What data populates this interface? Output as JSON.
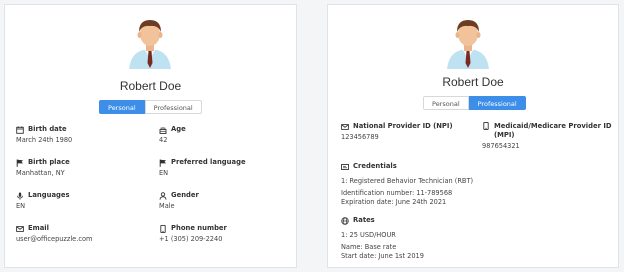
{
  "personal_card": {
    "name": "Robert Doe",
    "tabs": [
      {
        "label": "Personal",
        "active": true
      },
      {
        "label": "Professional",
        "active": false
      }
    ],
    "fields": [
      {
        "label": "Birth date",
        "value": "March 24th 1980",
        "icon": "calendar-icon"
      },
      {
        "label": "Age",
        "value": "42",
        "icon": "cake-icon"
      },
      {
        "label": "Birth place",
        "value": "Manhattan, NY",
        "icon": "flag-icon"
      },
      {
        "label": "Preferred language",
        "value": "EN",
        "icon": "flag-icon"
      },
      {
        "label": "Languages",
        "value": "EN",
        "icon": "microphone-icon"
      },
      {
        "label": "Gender",
        "value": "Male",
        "icon": "person-icon"
      },
      {
        "label": "Email",
        "value": "user@officepuzzle.com",
        "icon": "envelope-icon"
      },
      {
        "label": "Phone number",
        "value": "+1 (305) 209-2240",
        "icon": "phone-icon"
      }
    ]
  },
  "professional_card": {
    "name": "Robert Doe",
    "tabs": [
      {
        "label": "Personal",
        "active": false
      },
      {
        "label": "Professional",
        "active": true
      }
    ],
    "npi": {
      "label": "National Provider ID (NPI)",
      "value": "123456789",
      "icon": "envelope-icon"
    },
    "medicaid": {
      "label": "Medicaid/Medicare Provider ID (MPI)",
      "value": "987654321",
      "icon": "phone-icon"
    },
    "credentials": {
      "title": "Credentials",
      "icon": "id-card-icon",
      "item": "1: Registered Behavior Technician (RBT)",
      "id_line": "Identification number: 11-789568",
      "exp_line": "Expiration date: June 24th 2021"
    },
    "rates": {
      "title": "Rates",
      "icon": "globe-icon",
      "item": "1: 25 USD/HOUR",
      "name_line": "Name: Base rate",
      "start_line": "Start date: June 1st 2019"
    }
  },
  "colors": {
    "accent": "#3c8ee8",
    "border": "#e1e3e6",
    "text": "#333333"
  }
}
